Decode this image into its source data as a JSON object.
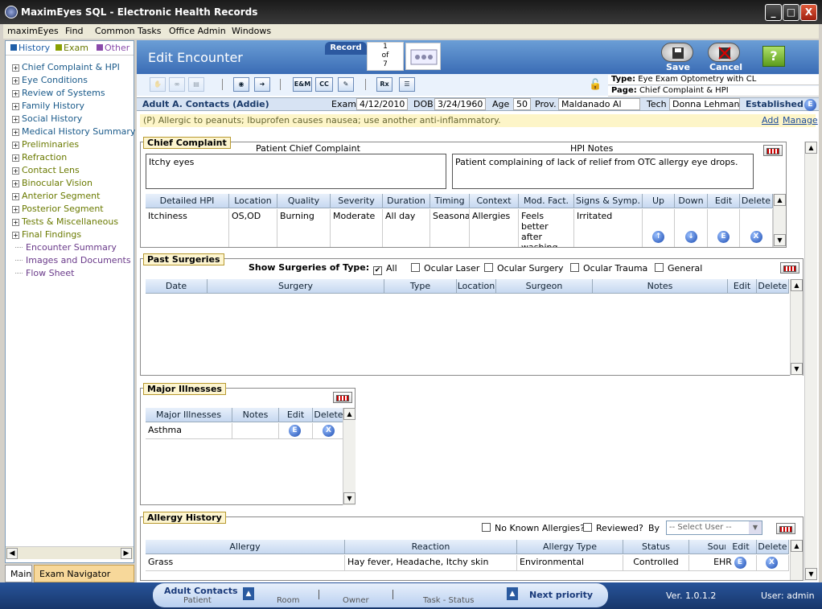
{
  "window": {
    "title": "MaximEyes SQL - Electronic Health Records",
    "min": "_",
    "max": "□",
    "close": "X"
  },
  "menu": [
    "maximEyes",
    "Find",
    "Common Tasks",
    "Office Admin",
    "Windows"
  ],
  "legend": {
    "history": "History",
    "exam": "Exam",
    "other": "Other",
    "colors": {
      "history": "#1f5fa8",
      "exam": "#8aa000",
      "other": "#8a4aaa"
    }
  },
  "tree": [
    {
      "label": "Chief Complaint & HPI",
      "kind": "history"
    },
    {
      "label": "Eye Conditions",
      "kind": "history"
    },
    {
      "label": "Review of Systems",
      "kind": "history"
    },
    {
      "label": "Family History",
      "kind": "history"
    },
    {
      "label": "Social History",
      "kind": "history"
    },
    {
      "label": "Medical History Summary",
      "kind": "history"
    },
    {
      "label": "Preliminaries",
      "kind": "exam"
    },
    {
      "label": "Refraction",
      "kind": "exam"
    },
    {
      "label": "Contact Lens",
      "kind": "exam"
    },
    {
      "label": "Binocular Vision",
      "kind": "exam"
    },
    {
      "label": "Anterior Segment",
      "kind": "exam"
    },
    {
      "label": "Posterior Segment",
      "kind": "exam"
    },
    {
      "label": "Tests & Miscellaneous",
      "kind": "exam"
    },
    {
      "label": "Final Findings",
      "kind": "exam"
    },
    {
      "label": "Encounter Summary",
      "kind": "other"
    },
    {
      "label": "Images and Documents",
      "kind": "other"
    },
    {
      "label": "Flow Sheet",
      "kind": "other"
    }
  ],
  "left_tabs": {
    "main": "Main",
    "exam_nav": "Exam Navigator"
  },
  "header": {
    "title": "Edit Encounter",
    "record_label": "Record",
    "record_current": "1",
    "record_of": "of",
    "record_total": "7",
    "save": "Save",
    "cancel": "Cancel",
    "help": "?"
  },
  "toolbar": {
    "em": "E&M",
    "cc": "CC",
    "rx": "Rx"
  },
  "type_box": {
    "type_label": "Type:",
    "type_value": "Eye Exam Optometry with CL",
    "page_label": "Page:",
    "page_value": "Chief Complaint & HPI"
  },
  "patient": {
    "name": "Adult A. Contacts (Addie)",
    "exam_label": "Exam",
    "exam_date": "4/12/2010",
    "dob_label": "DOB",
    "dob": "3/24/1960",
    "age_label": "Age",
    "age": "50",
    "prov_label": "Prov.",
    "prov": "Maldanado  Al",
    "tech_label": "Tech",
    "tech": "Donna   Lehman",
    "status": "Established"
  },
  "alert": {
    "text": "(P) Allergic to peanuts; Ibuprofen causes nausea; use another anti-inflammatory.",
    "add": "Add",
    "manage": "Manage"
  },
  "chief_complaint": {
    "title": "Chief Complaint",
    "pcc_label": "Patient Chief Complaint",
    "pcc_value": "Itchy eyes",
    "hpi_label": "HPI Notes",
    "hpi_value": "Patient complaining of lack of relief from OTC allergy eye drops.",
    "columns": [
      "Detailed HPI",
      "Location",
      "Quality",
      "Severity",
      "Duration",
      "Timing",
      "Context",
      "Mod. Fact.",
      "Signs & Symp.",
      "Up",
      "Down",
      "Edit",
      "Delete"
    ],
    "row": [
      "Itchiness",
      "OS,OD",
      "Burning",
      "Moderate",
      "All day",
      "Seasonal",
      "Allergies",
      "Feels better after washing with cold",
      "Irritated"
    ]
  },
  "past_surgeries": {
    "title": "Past Surgeries",
    "filter_label": "Show Surgeries of Type:",
    "filters": [
      "All",
      "Ocular Laser",
      "Ocular Surgery",
      "Ocular Trauma",
      "General"
    ],
    "columns": [
      "Date",
      "Surgery",
      "Type",
      "Location",
      "Surgeon",
      "Notes",
      "Edit",
      "Delete"
    ]
  },
  "major_illnesses": {
    "title": "Major Illnesses",
    "columns": [
      "Major Illnesses",
      "Notes",
      "Edit",
      "Delete"
    ],
    "rows": [
      "Asthma"
    ]
  },
  "allergy_history": {
    "title": "Allergy History",
    "nka": "No Known Allergies?",
    "reviewed": "Reviewed?",
    "by": "By",
    "select_placeholder": "-- Select User --",
    "columns": [
      "Allergy",
      "Reaction",
      "Allergy Type",
      "Status",
      "Source",
      "Edit",
      "Delete"
    ],
    "row": [
      "Grass",
      "Hay fever, Headache, Itchy skin",
      "Environmental",
      "Controlled",
      "EHR"
    ]
  },
  "status": {
    "patient_name": "Adult Contacts",
    "patient_label": "Patient",
    "room_label": "Room",
    "owner_label": "Owner",
    "task_label": "Task - Status",
    "next": "Next priority",
    "version": "Ver. 1.0.1.2",
    "user": "User: admin"
  },
  "icons": {
    "edit": "edit-circle-icon",
    "delete": "delete-x-icon",
    "up": "up-arrow-icon",
    "down": "down-arrow-icon"
  }
}
